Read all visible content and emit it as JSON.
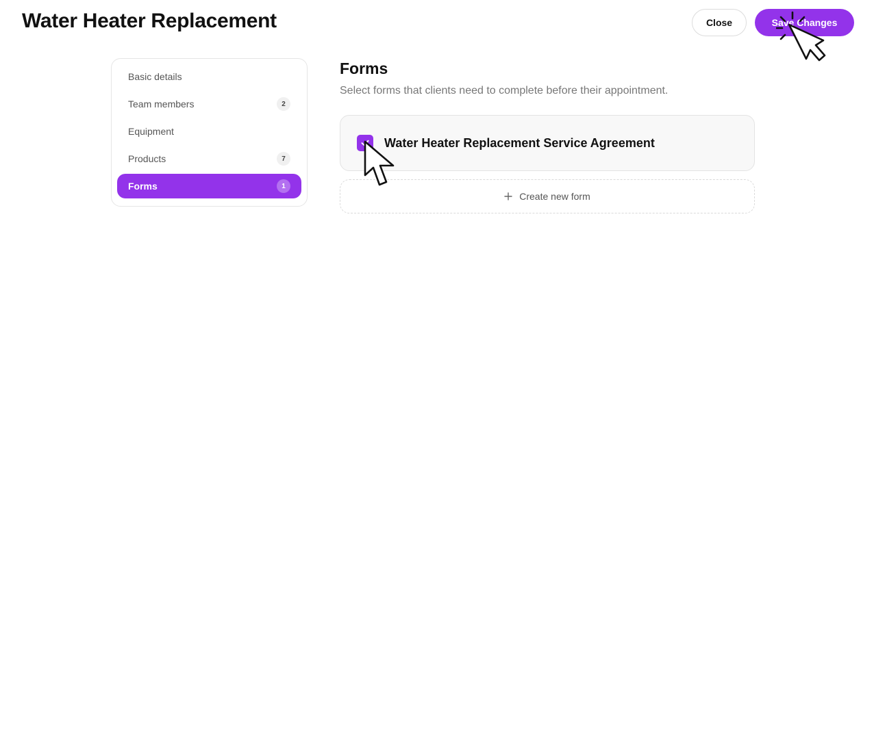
{
  "header": {
    "title": "Water Heater Replacement",
    "close_label": "Close",
    "save_label": "Save Changes"
  },
  "sidebar": {
    "items": [
      {
        "label": "Basic details",
        "badge": ""
      },
      {
        "label": "Team members",
        "badge": "2"
      },
      {
        "label": "Equipment",
        "badge": ""
      },
      {
        "label": "Products",
        "badge": "7"
      },
      {
        "label": "Forms",
        "badge": "1",
        "active": true
      }
    ]
  },
  "main": {
    "title": "Forms",
    "subtitle": "Select forms that clients need to complete before their appointment.",
    "forms": [
      {
        "label": "Water Heater Replacement Service Agreement",
        "checked": true
      }
    ],
    "create_label": "Create new form"
  },
  "colors": {
    "accent": "#9333ea"
  },
  "icons": {
    "checkbox": "check-icon",
    "create": "plus-icon",
    "pointer": "mouse-pointer-icon",
    "click": "mouse-click-icon"
  }
}
